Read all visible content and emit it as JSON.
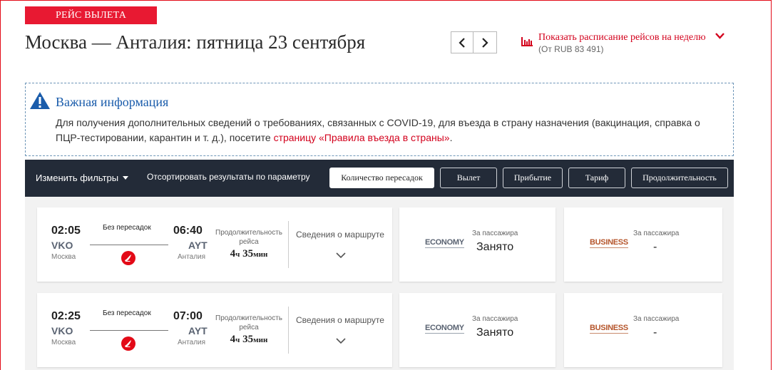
{
  "header": {
    "badge": "РЕЙС ВЫЛЕТА",
    "route_title": "Москва — Анталия: пятница 23 сентября",
    "week_schedule_link": "Показать расписание рейсов на неделю",
    "week_price": "(От RUB 83 491)"
  },
  "info_box": {
    "title": "Важная информация",
    "text": "Для получения дополнительных сведений о требованиях, связанных с COVID-19, для въезда в страну назначения (вакцинация, справка о ПЦР-тестировании, карантин и т. д.), посетите ",
    "link": "страницу «Правила въезда в страны»",
    "text_end": "."
  },
  "toolbar": {
    "filters_label": "Изменить фильтры",
    "sort_label": "Отсортировать результаты по параметру",
    "sort_options": [
      "Количество пересадок",
      "Вылет",
      "Прибытие",
      "Тариф",
      "Продолжительность"
    ],
    "active_sort": "Количество пересадок"
  },
  "flights": [
    {
      "dep_time": "02:05",
      "dep_code": "VKO",
      "dep_city": "Москва",
      "arr_time": "06:40",
      "arr_code": "AYT",
      "arr_city": "Анталия",
      "stops": "Без пересадок",
      "duration_label_1": "Продолжительность",
      "duration_label_2": "рейса",
      "duration_h": "4",
      "duration_h_unit": "ч",
      "duration_m": "35",
      "duration_m_unit": "мин",
      "details": "Сведения о маршруте",
      "economy": {
        "cabin": "ECONOMY",
        "per_pax": "За пассажира",
        "status": "Занято"
      },
      "business": {
        "cabin": "BUSINESS",
        "per_pax": "За пассажира",
        "status": "-"
      }
    },
    {
      "dep_time": "02:25",
      "dep_code": "VKO",
      "dep_city": "Москва",
      "arr_time": "07:00",
      "arr_code": "AYT",
      "arr_city": "Анталия",
      "stops": "Без пересадок",
      "duration_label_1": "Продолжительность",
      "duration_label_2": "рейса",
      "duration_h": "4",
      "duration_h_unit": "ч",
      "duration_m": "35",
      "duration_m_unit": "мин",
      "details": "Сведения о маршруте",
      "economy": {
        "cabin": "ECONOMY",
        "per_pax": "За пассажира",
        "status": "Занято"
      },
      "business": {
        "cabin": "BUSINESS",
        "per_pax": "За пассажира",
        "status": "-"
      }
    }
  ],
  "colors": {
    "brand_red": "#e81932",
    "link_red": "#d3001c",
    "toolbar_bg": "#232b38",
    "info_blue": "#1a5cab"
  },
  "icons": [
    "chevron-left-icon",
    "chevron-right-icon",
    "bar-chart-icon",
    "chevron-down-icon",
    "warning-icon",
    "turkish-airlines-logo-icon"
  ]
}
